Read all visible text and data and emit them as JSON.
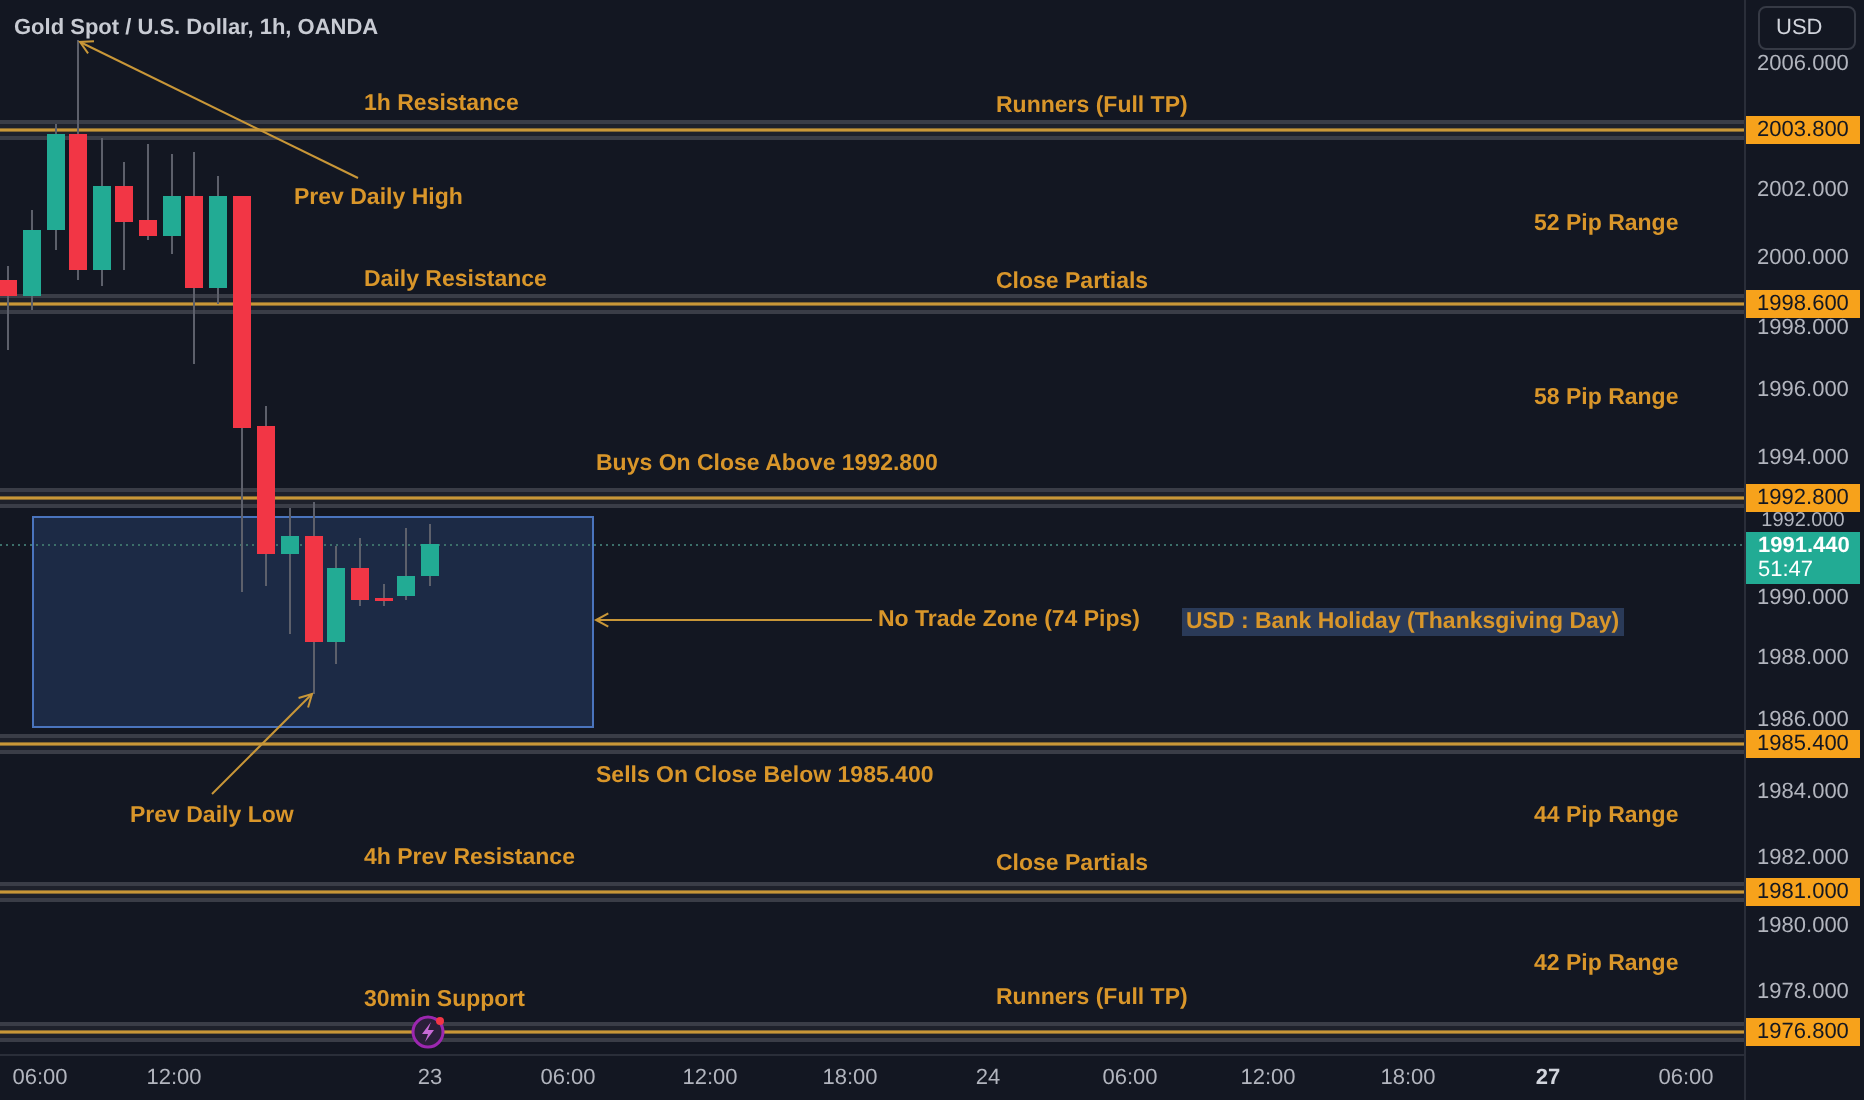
{
  "title": "Gold Spot / U.S. Dollar, 1h, OANDA",
  "currency_button": "USD",
  "price_axis": {
    "ticks": [
      "2006.000",
      "2002.000",
      "2000.000",
      "1998.000",
      "1996.000",
      "1994.000",
      "1992.000",
      "1990.000",
      "1988.000",
      "1986.000",
      "1984.000",
      "1982.000",
      "1980.000",
      "1978.000"
    ]
  },
  "levels": [
    {
      "price_tag": "2003.800"
    },
    {
      "price_tag": "1998.600"
    },
    {
      "price_tag": "1992.800"
    },
    {
      "price_tag": "1985.400"
    },
    {
      "price_tag": "1981.000"
    },
    {
      "price_tag": "1976.800"
    }
  ],
  "current_price": {
    "price": "1991.440",
    "countdown": "51:47"
  },
  "annotations": [
    {
      "kind": "label",
      "text": "1h Resistance"
    },
    {
      "kind": "label",
      "text": "Runners (Full TP)"
    },
    {
      "kind": "arrow_label",
      "text": "Prev Daily High"
    },
    {
      "kind": "label",
      "text": "52 Pip Range"
    },
    {
      "kind": "label",
      "text": "Daily Resistance"
    },
    {
      "kind": "label",
      "text": "Close Partials"
    },
    {
      "kind": "label",
      "text": "58 Pip Range"
    },
    {
      "kind": "label",
      "text": "Buys On Close Above 1992.800"
    },
    {
      "kind": "arrow_label",
      "text": "No Trade Zone (74 Pips)"
    },
    {
      "kind": "highlight",
      "text": "USD : Bank Holiday (Thanksgiving Day)"
    },
    {
      "kind": "label",
      "text": "Sells On Close Below 1985.400"
    },
    {
      "kind": "arrow_label",
      "text": "Prev Daily Low"
    },
    {
      "kind": "label",
      "text": "44 Pip Range"
    },
    {
      "kind": "label",
      "text": "4h Prev Resistance"
    },
    {
      "kind": "label",
      "text": "Close Partials"
    },
    {
      "kind": "label",
      "text": "42 Pip Range"
    },
    {
      "kind": "label",
      "text": "30min Support"
    },
    {
      "kind": "label",
      "text": "Runners (Full TP)"
    }
  ],
  "time_axis": {
    "ticks": [
      {
        "label": "06:00",
        "emphasized": false
      },
      {
        "label": "12:00",
        "emphasized": false
      },
      {
        "label": "23",
        "emphasized": false
      },
      {
        "label": "06:00",
        "emphasized": false
      },
      {
        "label": "12:00",
        "emphasized": false
      },
      {
        "label": "18:00",
        "emphasized": false
      },
      {
        "label": "24",
        "emphasized": false
      },
      {
        "label": "06:00",
        "emphasized": false
      },
      {
        "label": "12:00",
        "emphasized": false
      },
      {
        "label": "18:00",
        "emphasized": false
      },
      {
        "label": "27",
        "emphasized": true
      },
      {
        "label": "06:00",
        "emphasized": false
      }
    ]
  }
}
